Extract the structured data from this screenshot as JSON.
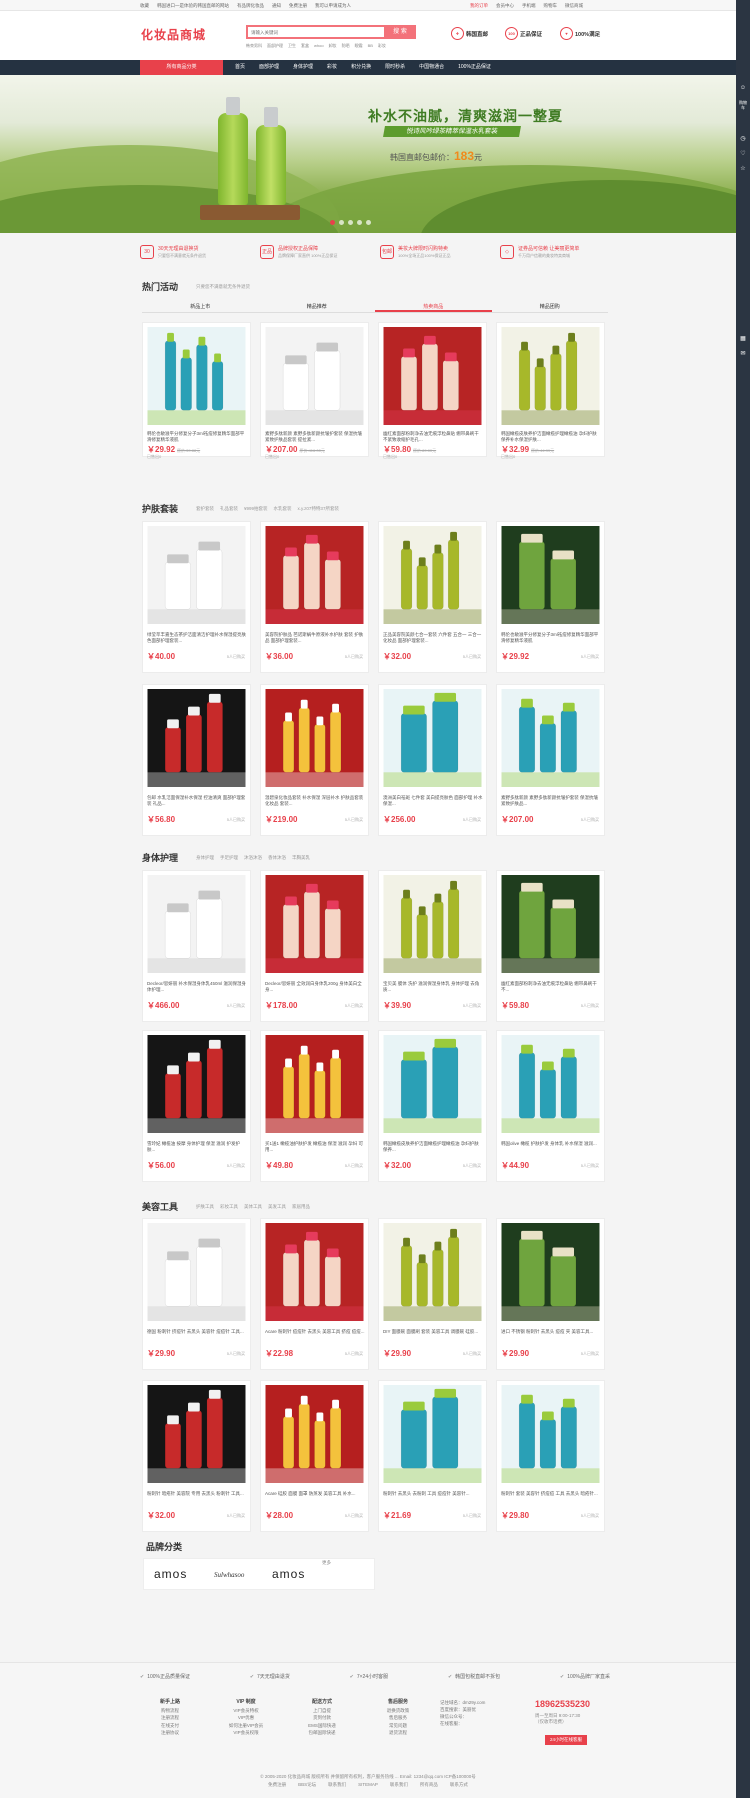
{
  "topbar": {
    "left": [
      "收藏",
      "韩国进口一是体验的韩国直邮的网站",
      "有品牌化妆品",
      "通知",
      "免费注册",
      "我可以申请成为人"
    ],
    "right": [
      "我的订单",
      "会员中心",
      "手机端",
      "购物车",
      "微信商城"
    ]
  },
  "header": {
    "logo": "化妆品商城",
    "search_placeholder": "请输入关键词",
    "search_btn": "搜 索",
    "hot_words": [
      "韩束男科",
      "面部护理",
      "卫生",
      "套盒",
      "whoo",
      "卸妆",
      "防晒",
      "眼霜",
      "BB",
      "彩妆"
    ],
    "badges": [
      "韩国直邮",
      "正品保证",
      "100%满足"
    ]
  },
  "nav": {
    "all": "所有商品分类",
    "items": [
      "首页",
      "面部护理",
      "身体护理",
      "彩妆",
      "积分兑换",
      "限时秒杀",
      "中国物通合",
      "100%正品保证"
    ]
  },
  "banner": {
    "title": "补水不油腻，清爽滋润一整夏",
    "subtitle": "悦诗风吟绿茶精萃保湿水乳套装",
    "price_prefix": "韩国直邮包邮价：",
    "price": "183",
    "price_unit": "元"
  },
  "promos": [
    {
      "icon": "30",
      "t1": "30天无理由退换货",
      "t2": "只要您不满意就无条件退货"
    },
    {
      "icon": "正品",
      "t1": "品牌授权正品保障",
      "t2": "品牌保障厂家直供 100%正品保证"
    },
    {
      "icon": "包邮",
      "t1": "美妆大牌限时闪购特卖",
      "t2": "100%全场正品100%保证正品"
    },
    {
      "icon": "◇",
      "t1": "证券品可信赖 让美丽更简单",
      "t2": "千万用户信赖的美妆特卖商城"
    }
  ],
  "hot": {
    "title": "热门活动",
    "sub": "只要您不满意就无条件退货",
    "tabs": [
      "新品上市",
      "精品推荐",
      "热卖商品",
      "精品团购"
    ]
  },
  "hot_cards": [
    {
      "name": "韩伦也敏滋平分修复分子3ml祛痘修复精华面部平滑修复精华液肌",
      "price": "￥29.92",
      "old": "原价:39.88元",
      "sold": "已售出0"
    },
    {
      "name": "素野多肽新颜 素野多肽新颜抗皱护套装 保湿抗皱紧致护肤品套装 提拉紧...",
      "price": "￥207.00",
      "old": "原价:416.00元",
      "sold": "已售出0"
    },
    {
      "name": "幽红素面部粉刺净去油无痕浮粒鼻贴 绷带鼻刷干不紧致收缩护毛孔...",
      "price": "￥59.80",
      "old": "原价:89.00元",
      "sold": "已售出0"
    },
    {
      "name": "韩国橄榄皮肤养护洁面橄榄护理橄榄油 孕妇护肤保养补水保湿护肤...",
      "price": "￥32.99",
      "old": "原价:44.99元",
      "sold": "已售出0"
    }
  ],
  "skincare": {
    "title": "护肤套装",
    "tags": [
      "套护套装",
      "礼品套装",
      "¥999拍套装",
      "水乳套装",
      "x.y.z07特特37所套装"
    ]
  },
  "skin_cards": [
    {
      "name": "绿莹萃丰嘉生态茶护洁面清洁护理补水保湿提亮肤色面部护理套装...",
      "price": "￥40.00",
      "sold": "5人已购买"
    },
    {
      "name": "美容院护肤品 芭诺斯蜗牛原液补水护肤 套装 护肤品 面部护理套装...",
      "price": "￥36.00",
      "sold": "5人已购买"
    },
    {
      "name": "正品美容院美颜七合一套装 六件套 五合一 三合一化妆品 面部护理套装...",
      "price": "￥32.00",
      "sold": "5人已购买"
    },
    {
      "name": "韩伦也敏滋平分修复分子3ml祛痘修复精华面部平滑修复精华液肌",
      "price": "￥29.92",
      "sold": "5人已购买"
    },
    {
      "name": "包邮 水乳洁面保湿补水保湿 控油清爽 面部护理套装 礼品...",
      "price": "￥56.80",
      "sold": "5人已购买"
    },
    {
      "name": "温碧泉化妆品套装 补水保湿 深层补水 护肤品套装 化妆品 套装...",
      "price": "￥219.00",
      "sold": "5人已购买"
    },
    {
      "name": "澳洲美白祛斑 七件套 美白提亮肤色 面部护理 补水保湿...",
      "price": "￥256.00",
      "sold": "5人已购买"
    },
    {
      "name": "素野多肽新颜 素野多肽新颜抗皱护套装 保湿抗皱紧致护肤品...",
      "price": "￥207.00",
      "sold": "5人已购买"
    }
  ],
  "body": {
    "title": "身体护理",
    "tags": [
      "身体护理",
      "手足护理",
      "沐浴沐浴",
      "香体沐浴",
      "丰胸美乳"
    ]
  },
  "body_cards": [
    {
      "name": "Decleor/思妍丽 补水保湿身体乳450ml 滋润保湿身体护理...",
      "price": "￥466.00",
      "sold": "5人已购买"
    },
    {
      "name": "Decleor/思妍丽 全效润白身体乳200g 身体美白全身...",
      "price": "￥178.00",
      "sold": "5人已购买"
    },
    {
      "name": "宝贝美 膜体 洗护 滋润保湿身体乳 身体护理 去角质...",
      "price": "￥39.90",
      "sold": "5人已购买"
    },
    {
      "name": "幽红素面部粉刺净去油无痕浮粒鼻贴 绷带鼻刷干不...",
      "price": "￥59.80",
      "sold": "5人已购买"
    },
    {
      "name": "雪玲妃 橄榄油 按摩 身体护理 保湿 滋润 护发护肤...",
      "price": "￥56.00",
      "sold": "5人已购买"
    },
    {
      "name": "买1送1 橄榄油护肤护发 橄榄油 保湿 滋润 孕妇 可用...",
      "price": "￥49.80",
      "sold": "5人已购买"
    },
    {
      "name": "韩国橄榄皮肤养护洁面橄榄护理橄榄油 孕妇护肤保养...",
      "price": "￥32.00",
      "sold": "5人已购买"
    },
    {
      "name": "韩国olive 橄榄 护肤护发 身体乳 补水保湿 滋润...",
      "price": "￥44.90",
      "sold": "5人已购买"
    }
  ],
  "tools": {
    "title": "美容工具",
    "tags": [
      "护肤工具",
      "彩妆工具",
      "美体工具",
      "美发工具",
      "家居用品"
    ]
  },
  "tool_cards": [
    {
      "name": "德国 粉刺针 挤痘针 去黑头 美容针 痘痘针 工具...",
      "price": "￥29.90",
      "sold": "5人已购买"
    },
    {
      "name": "Acare 粉刺针 痘痘针 去黑头 美容工具 挤痘 痘痘...",
      "price": "￥22.98",
      "sold": "5人已购买"
    },
    {
      "name": "DIY 面膜碗 面膜刷 套装 美容工具 调膜碗 硅胶...",
      "price": "￥29.90",
      "sold": "5人已购买"
    },
    {
      "name": "进口 不锈钢 粉刺针 去黑头 痘痘 夹 美容工具...",
      "price": "￥29.90",
      "sold": "5人已购买"
    },
    {
      "name": "粉刺针 暗疮针 美容院 专用 去黑头 粉刺针 工具...",
      "price": "￥32.00",
      "sold": "5人已购买"
    },
    {
      "name": "Acare 硅胶 面膜 面罩 防蒸发 美容工具 补水...",
      "price": "￥28.00",
      "sold": "5人已购买"
    },
    {
      "name": "粉刺针 去黑头 去粉刺 工具 痘痘针 美容针...",
      "price": "￥21.69",
      "sold": "5人已购买"
    },
    {
      "name": "粉刺针 套装 美容针 挤痘痘 工具 去黑头 暗疮针...",
      "price": "￥29.80",
      "sold": "5人已购买"
    }
  ],
  "brands": {
    "title": "品牌分类",
    "items": [
      "amos",
      "Sulwhasoo",
      "amos"
    ],
    "more": "更多"
  },
  "footer": {
    "guarantees": [
      "100%正品质量保证",
      "7天无理由退货",
      "7×24小时客服",
      "韩国包税直邮不拆包",
      "100%品牌厂家直采"
    ],
    "cols": [
      {
        "title": "新手上路",
        "items": [
          "购物流程",
          "注册流程",
          "在线支付",
          "注册协议"
        ]
      },
      {
        "title": "VIP 制度",
        "items": [
          "VIP会员特权",
          "VIP优惠",
          "如何注册VIP会员",
          "VIP会员权限"
        ]
      },
      {
        "title": "配送方式",
        "items": [
          "上门自提",
          "货到付款",
          "EMS国际快递",
          "包邮国际快递"
        ]
      },
      {
        "title": "售后服务",
        "items": [
          "退换货政策",
          "售后服务",
          "常见问题",
          "退货流程"
        ]
      }
    ],
    "contact": [
      "记住域名：dm29y.com",
      "百度搜索：美丽优",
      "微信公众号：",
      "在线客服："
    ],
    "phone": "18962535230",
    "hours": [
      "周一至周日 9:00-17:30",
      "（仅收市话费）"
    ],
    "btn": "24小时在线客服",
    "copy": "© 2005-2020 化妆品商城 版权所有 并保留所有权利，客户服务热线 ... Email: 1234@qq.com ICP备100000号",
    "links": [
      "免费注册",
      "BBS论坛",
      "联系我们",
      "SITEMAP",
      "联系我们",
      "所有商品",
      "联系方式"
    ]
  }
}
